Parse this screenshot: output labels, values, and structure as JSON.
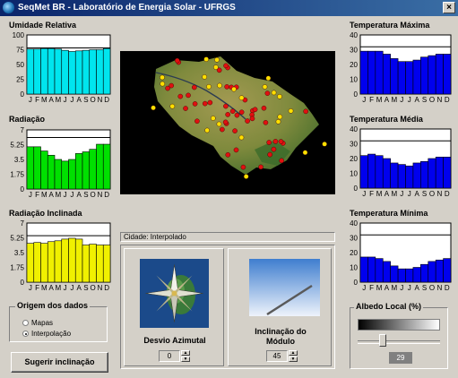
{
  "window": {
    "title": "SeqMet BR - Laboratório de Energia Solar - UFRGS",
    "close_label": "×"
  },
  "months": [
    "J",
    "F",
    "M",
    "A",
    "M",
    "J",
    "J",
    "A",
    "S",
    "O",
    "N",
    "D"
  ],
  "charts": {
    "umidade": {
      "title": "Umidade Relativa",
      "color": "#00e5ee",
      "ticks": [
        "100",
        "75",
        "50",
        "25",
        "0"
      ],
      "ymax": 100,
      "refline": 78,
      "chart_data": {
        "type": "bar",
        "values": [
          76,
          76,
          77,
          77,
          76,
          74,
          72,
          73,
          74,
          75,
          75,
          77
        ]
      }
    },
    "radiacao": {
      "title": "Radiação",
      "color": "#00e000",
      "ticks": [
        "7",
        "5.25",
        "3.5",
        "1.75",
        "0"
      ],
      "ymax": 7,
      "refline": 6.1,
      "chart_data": {
        "type": "bar",
        "values": [
          5.0,
          5.0,
          4.5,
          4.0,
          3.5,
          3.3,
          3.5,
          4.2,
          4.4,
          4.7,
          5.3,
          5.3
        ]
      }
    },
    "radiacao_inclinada": {
      "title": "Radiação Inclinada",
      "color": "#f0f000",
      "ticks": [
        "7",
        "5.25",
        "3.5",
        "1.75",
        "0"
      ],
      "ymax": 7,
      "refline": 5.5,
      "chart_data": {
        "type": "bar",
        "values": [
          4.6,
          4.7,
          4.6,
          4.8,
          4.9,
          5.1,
          5.2,
          5.1,
          4.4,
          4.5,
          4.4,
          4.4
        ]
      }
    },
    "temp_max": {
      "title": "Temperatura Máxima",
      "color": "#0000ee",
      "ticks": [
        "40",
        "30",
        "20",
        "10",
        "0"
      ],
      "ymax": 40,
      "refline": 32,
      "chart_data": {
        "type": "bar",
        "values": [
          29,
          29,
          29,
          27,
          24,
          22,
          22,
          23,
          25,
          26,
          27,
          27
        ]
      }
    },
    "temp_media": {
      "title": "Temperatura Média",
      "color": "#0000ee",
      "ticks": [
        "40",
        "30",
        "20",
        "10",
        "0"
      ],
      "ymax": 40,
      "refline": 32,
      "chart_data": {
        "type": "bar",
        "values": [
          22,
          23,
          22,
          20,
          17,
          16,
          15,
          17,
          18,
          20,
          21,
          21
        ]
      }
    },
    "temp_min": {
      "title": "Temperatura Mínima",
      "color": "#0000ee",
      "ticks": [
        "40",
        "30",
        "20",
        "10",
        "0"
      ],
      "ymax": 40,
      "refline": 32,
      "chart_data": {
        "type": "bar",
        "values": [
          17,
          17,
          16,
          14,
          11,
          9,
          9,
          10,
          12,
          14,
          15,
          16
        ]
      }
    }
  },
  "status_text": "Cidade: Interpolado",
  "desvio": {
    "label": "Desvio Azimutal",
    "value": "0"
  },
  "inclinacao": {
    "label_line1": "Inclinação do",
    "label_line2": "Módulo",
    "value": "45"
  },
  "origem": {
    "title": "Origem dos dados",
    "options": [
      "Mapas",
      "Interpolação"
    ],
    "selected": "Interpolação"
  },
  "sugerir_button": "Sugerir inclinação",
  "albedo": {
    "title": "Albedo Local (%)",
    "value": "29",
    "fraction": 0.29
  },
  "map": {
    "red_markers": 48,
    "yellow_markers": 26
  }
}
